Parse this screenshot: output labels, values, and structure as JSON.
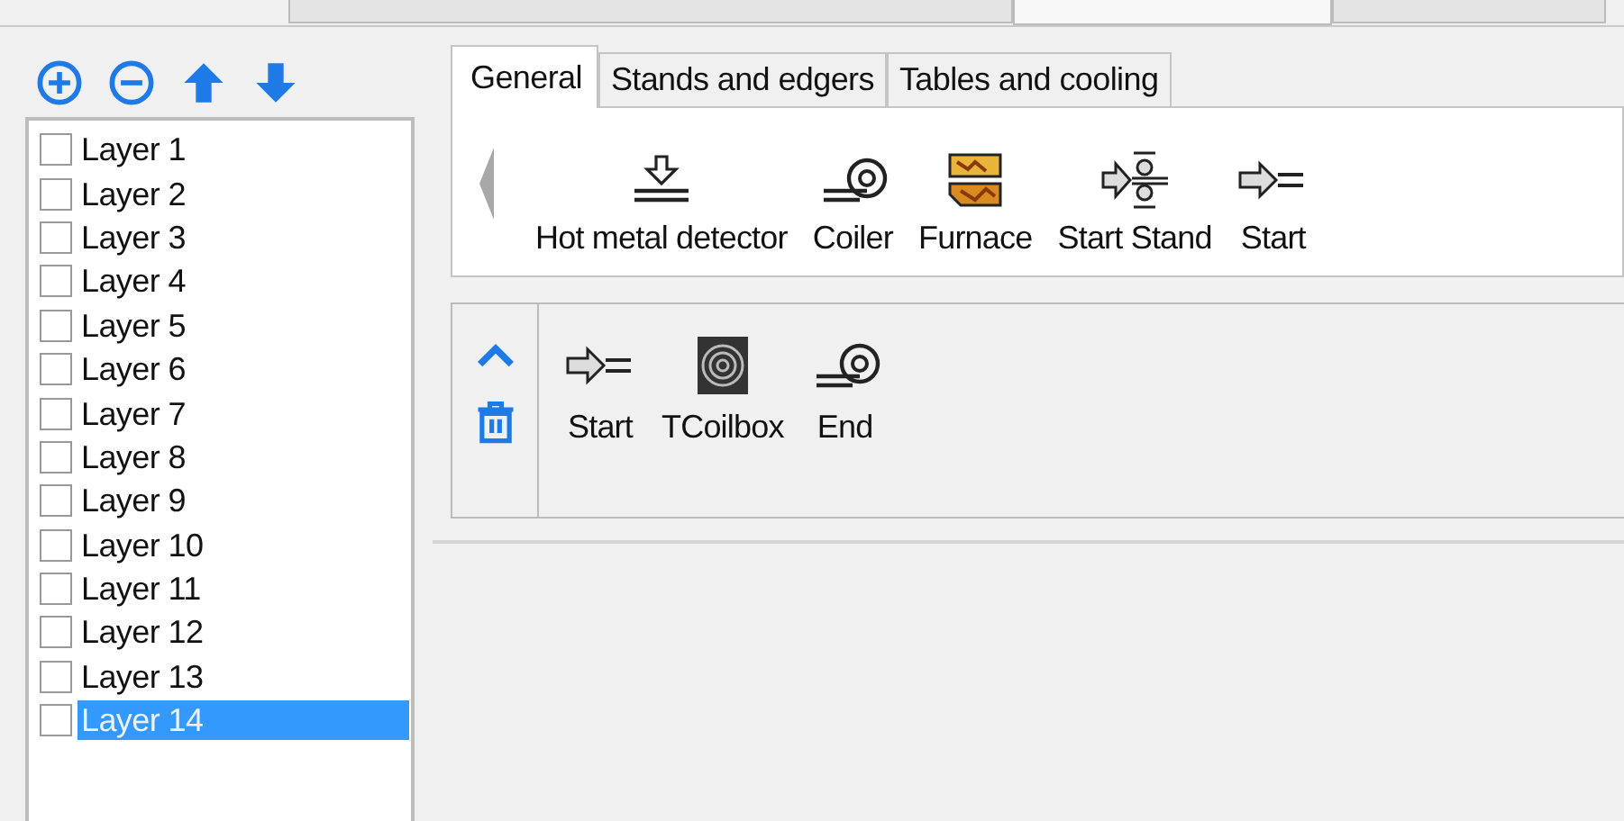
{
  "top_tabs": [
    {
      "selected": false
    },
    {
      "selected": true
    },
    {
      "selected": false
    }
  ],
  "toolbar": {
    "buttons": [
      {
        "kind": "add"
      },
      {
        "kind": "remove"
      },
      {
        "kind": "up"
      },
      {
        "kind": "down"
      }
    ]
  },
  "layers": [
    {
      "label": "Layer 1",
      "checked": false,
      "selected": false
    },
    {
      "label": "Layer 2",
      "checked": false,
      "selected": false
    },
    {
      "label": "Layer 3",
      "checked": false,
      "selected": false
    },
    {
      "label": "Layer 4",
      "checked": false,
      "selected": false
    },
    {
      "label": "Layer 5",
      "checked": false,
      "selected": false
    },
    {
      "label": "Layer 6",
      "checked": false,
      "selected": false
    },
    {
      "label": "Layer 7",
      "checked": false,
      "selected": false
    },
    {
      "label": "Layer 8",
      "checked": false,
      "selected": false
    },
    {
      "label": "Layer 9",
      "checked": false,
      "selected": false
    },
    {
      "label": "Layer 10",
      "checked": false,
      "selected": false
    },
    {
      "label": "Layer 11",
      "checked": false,
      "selected": false
    },
    {
      "label": "Layer 12",
      "checked": false,
      "selected": false
    },
    {
      "label": "Layer 13",
      "checked": false,
      "selected": false
    },
    {
      "label": "Layer 14",
      "checked": false,
      "selected": true
    }
  ],
  "tabs": [
    {
      "label": "General",
      "selected": true
    },
    {
      "label": "Stands and edgers",
      "selected": false
    },
    {
      "label": "Tables and cooling",
      "selected": false
    }
  ],
  "palette": [
    {
      "label": "Hot metal detector",
      "kind": "detector"
    },
    {
      "label": "Coiler",
      "kind": "coiler"
    },
    {
      "label": "Furnace",
      "kind": "furnace"
    },
    {
      "label": "Start Stand",
      "kind": "stand"
    },
    {
      "label": "Start",
      "kind": "start"
    }
  ],
  "sequence": {
    "tools": [
      {
        "kind": "up"
      },
      {
        "kind": "delete"
      }
    ],
    "items": [
      {
        "label": "Start",
        "kind": "start"
      },
      {
        "label": "TCoilbox",
        "kind": "coilbox"
      },
      {
        "label": "End",
        "kind": "coiler"
      }
    ]
  }
}
